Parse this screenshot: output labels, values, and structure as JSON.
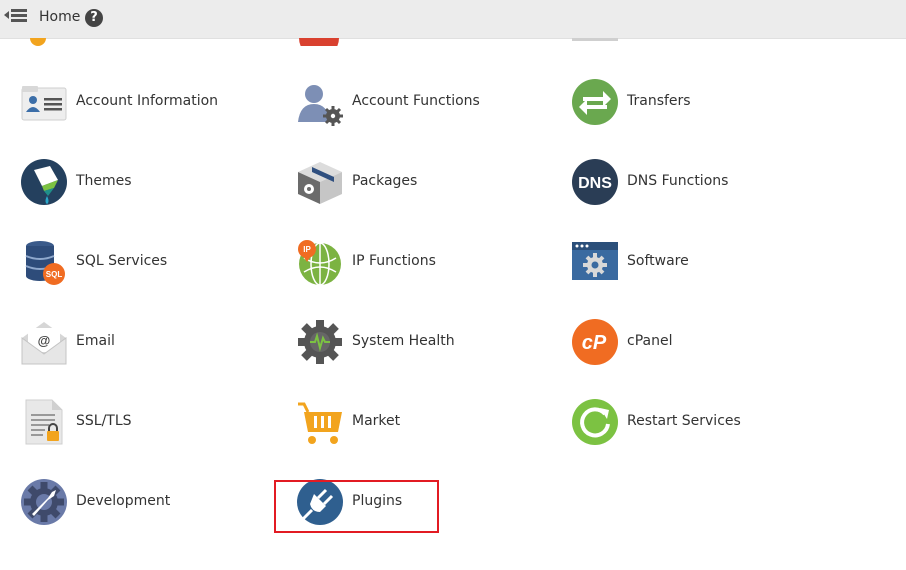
{
  "header": {
    "home_label": "Home",
    "help_symbol": "?"
  },
  "items": [
    {
      "label": "Account Information",
      "icon": "account-information-icon"
    },
    {
      "label": "Account Functions",
      "icon": "account-functions-icon"
    },
    {
      "label": "Transfers",
      "icon": "transfers-icon"
    },
    {
      "label": "Themes",
      "icon": "themes-icon"
    },
    {
      "label": "Packages",
      "icon": "packages-icon"
    },
    {
      "label": "DNS Functions",
      "icon": "dns-functions-icon"
    },
    {
      "label": "SQL Services",
      "icon": "sql-services-icon"
    },
    {
      "label": "IP Functions",
      "icon": "ip-functions-icon"
    },
    {
      "label": "Software",
      "icon": "software-icon"
    },
    {
      "label": "Email",
      "icon": "email-icon"
    },
    {
      "label": "System Health",
      "icon": "system-health-icon"
    },
    {
      "label": "cPanel",
      "icon": "cpanel-icon"
    },
    {
      "label": "SSL/TLS",
      "icon": "ssl-tls-icon"
    },
    {
      "label": "Market",
      "icon": "market-icon"
    },
    {
      "label": "Restart Services",
      "icon": "restart-services-icon"
    },
    {
      "label": "Development",
      "icon": "development-icon"
    },
    {
      "label": "Plugins",
      "icon": "plugins-icon"
    }
  ],
  "icon_text": {
    "dns": "DNS",
    "sql": "SQL",
    "ip": "IP",
    "cpanel": "cP",
    "email": "@"
  },
  "colors": {
    "highlight": "#e21b23",
    "green": "#6aa84f",
    "navy": "#2a3d55",
    "orange": "#f06c22",
    "blue": "#2f5f8f"
  }
}
